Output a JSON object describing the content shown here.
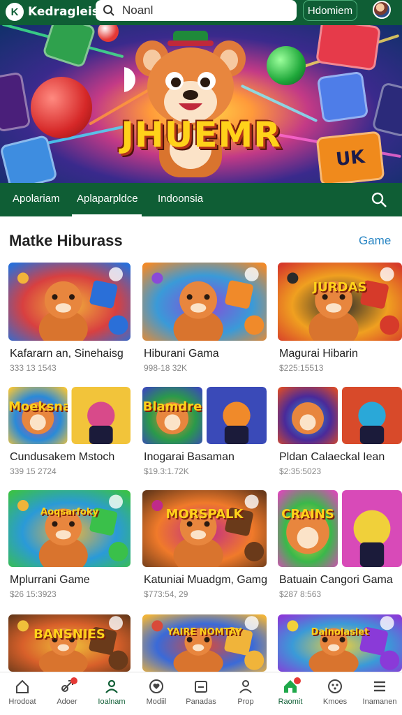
{
  "header": {
    "logo_mark": "K",
    "logo_text": "Kedragleis",
    "search_value": "Noanl",
    "button_label": "Hdomiem"
  },
  "hero": {
    "title": "JHUEMR",
    "cube_label": "UK"
  },
  "tabs": [
    {
      "label": "Apolariam"
    },
    {
      "label": "Aplaparpldce",
      "active": true
    },
    {
      "label": "Indoonsia"
    }
  ],
  "section": {
    "title": "Matke Hiburass",
    "link": "Game"
  },
  "cards": [
    {
      "title": "Kafararn an, Sinehaisg",
      "meta": "333 13 1543",
      "label": ""
    },
    {
      "title": "Hiburani Gama",
      "meta": "998-18 32K",
      "label": ""
    },
    {
      "title": "Magurai Hibarin",
      "meta": "$225:15513",
      "label": "JURDAS"
    },
    {
      "title": "Cundusakem Mstoch",
      "meta": "339 15 2724",
      "label": "Moeksnai"
    },
    {
      "title": "Inogarai Basaman",
      "meta": "$19.3:1.72K",
      "label": "Blamdre"
    },
    {
      "title": "Pldan Calaeckal Iean",
      "meta": "$2:35:5023",
      "label": ""
    },
    {
      "title": "Mplurrani Game",
      "meta": "$26 15:3923",
      "label": "Aoqsarfoky"
    },
    {
      "title": "Katuniai Muadgm, Gamg",
      "meta": "$773:54, 29",
      "label": "MORSPALK"
    },
    {
      "title": "Batuain Cangori Gama",
      "meta": "$287 8:563",
      "label": "CRAINS"
    },
    {
      "title": "",
      "meta": "",
      "label": "BANSNIES"
    },
    {
      "title": "",
      "meta": "",
      "label": "YAIRE NOMTAY"
    },
    {
      "title": "",
      "meta": "",
      "label": "Dalnolaslet"
    }
  ],
  "nav": [
    {
      "label": "Hrodoat",
      "icon": "home-icon"
    },
    {
      "label": "Adoer",
      "icon": "rocket-icon",
      "badge": true
    },
    {
      "label": "Ioalnam",
      "icon": "user-group-icon",
      "active": true
    },
    {
      "label": "Modiil",
      "icon": "heart-icon"
    },
    {
      "label": "Panadas",
      "icon": "folder-icon"
    },
    {
      "label": "Prop",
      "icon": "profile-icon"
    },
    {
      "label": "Raomit",
      "icon": "house-icon",
      "badge": true,
      "green": true
    },
    {
      "label": "Kmoes",
      "icon": "dice-icon"
    },
    {
      "label": "Inamanen",
      "icon": "menu-icon"
    }
  ],
  "colors": {
    "brand_green": "#0f5e35",
    "link_blue": "#2a86c4",
    "badge_red": "#e53935"
  }
}
